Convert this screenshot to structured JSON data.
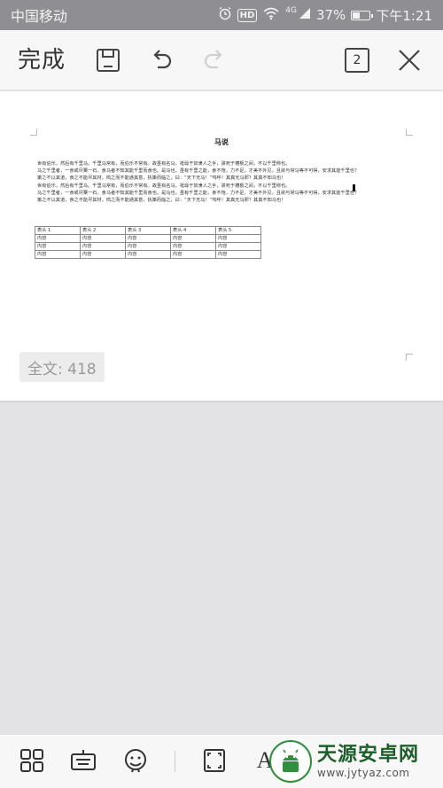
{
  "status_bar": {
    "carrier": "中国移动",
    "network": "4G",
    "battery": "37%",
    "battery_level": 0.37,
    "time": "下午1:21",
    "icons": [
      "alarm-icon",
      "hd-icon",
      "wifi-icon",
      "signal-icon",
      "battery-icon"
    ],
    "hd_label": "HD"
  },
  "toolbar": {
    "done_label": "完成",
    "page_count": "2",
    "icons": [
      "save-icon",
      "undo-icon",
      "redo-icon",
      "close-icon"
    ]
  },
  "document": {
    "title": "马说",
    "paragraphs": [
      "世有伯乐，然后有千里马。千里马常有，而伯乐不常有。故虽有名马，祗辱于奴隶人之手，骈死于槽枥之间，不以千里称也。",
      "马之千里者，一食或尽粟一石。食马者不知其能千里而食也。是马也，虽有千里之能，食不饱，力不足，才美不外见，且欲与常马等不可得，安求其能千里也？",
      "策之不以其道，食之不能尽其材，鸣之而不能通其意，执策而临之，曰：“天下无马！”呜呼！其真无马邪？其真不知马也！",
      "世有伯乐，然后有千里马。千里马常有，而伯乐不常有。故虽有名马，祗辱于奴隶人之手，骈死于槽枥之间，不以千里称也。",
      "马之千里者，一食或尽粟一石。食马者不知其能千里而食也。是马也，虽有千里之能，食不饱，力不足，才美不外见，且欲与常马等不可得，安求其能千里也？",
      "策之不以其道，食之不能尽其材，鸣之而不能通其意，执策而临之，曰：“天下无马！”呜呼！其真无马邪？其真不知马也！"
    ],
    "table": {
      "headers": [
        "表头 1",
        "表头 2",
        "表头 3",
        "表头 4",
        "表头 5"
      ],
      "rows": [
        [
          "内容",
          "内容",
          "内容",
          "内容",
          "内容"
        ],
        [
          "内容",
          "内容",
          "内容",
          "内容",
          "内容"
        ],
        [
          "内容",
          "内容",
          "内容",
          "内容",
          "内容"
        ]
      ]
    },
    "word_count": "全文: 418"
  },
  "bottom_bar": {
    "icons": [
      "grid-icon",
      "keyboard-icon",
      "emoji-icon",
      "fullscreen-icon",
      "text-format-icon"
    ],
    "text_format_label": "A"
  },
  "watermark": {
    "name": "天源安卓网",
    "url": "www.jytyaz.com"
  },
  "colors": {
    "status_bar_bg": "#8e8e93",
    "toolbar_bg": "#f7f7f7",
    "canvas_bg": "#e3e3e6",
    "watermark_green": "#2f8f3c"
  }
}
